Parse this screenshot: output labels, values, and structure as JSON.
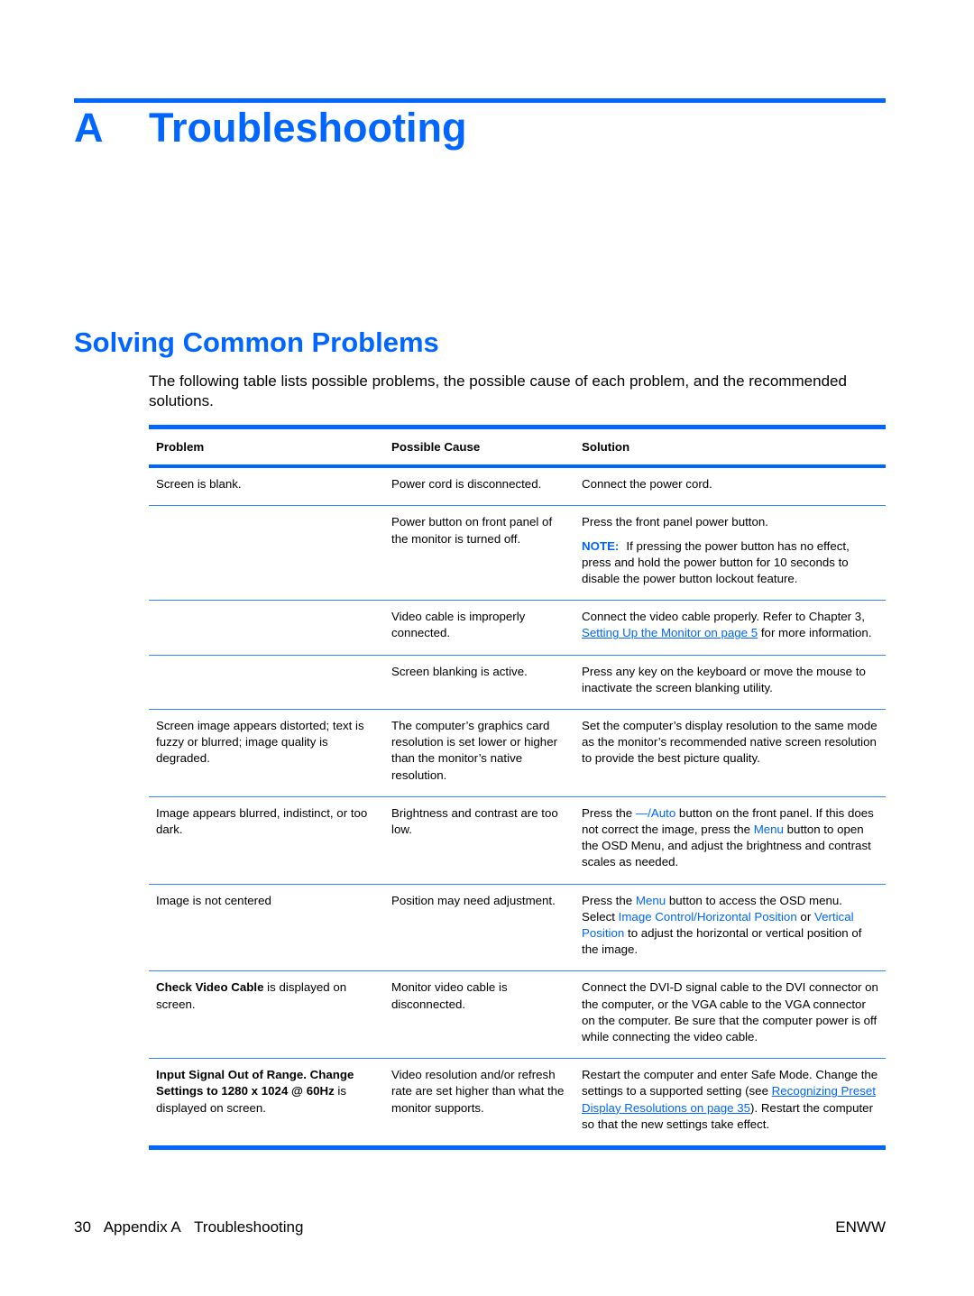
{
  "chapter": {
    "letter": "A",
    "title": "Troubleshooting"
  },
  "section": {
    "title": "Solving Common Problems"
  },
  "intro": "The following table lists possible problems, the possible cause of each problem, and the recommended solutions.",
  "table": {
    "headers": [
      "Problem",
      "Possible Cause",
      "Solution"
    ],
    "rows": [
      {
        "problem": "Screen is blank.",
        "cause": "Power cord is disconnected.",
        "solution": "Connect the power cord."
      },
      {
        "problem": "",
        "cause": "Power button on front panel of the monitor is turned off.",
        "solution": "Press the front panel power button.",
        "note_label": "NOTE:",
        "note": "If pressing the power button has no effect, press and hold the power button for 10 seconds to disable the power button lockout feature."
      },
      {
        "problem": "",
        "cause": "Video cable is improperly connected.",
        "solution_pre": "Connect the video cable properly. Refer to Chapter 3, ",
        "solution_link": "Setting Up the Monitor on page 5",
        "solution_post": " for more information."
      },
      {
        "problem": "",
        "cause": "Screen blanking is active.",
        "solution": "Press any key on the keyboard or move the mouse to inactivate the screen blanking utility."
      },
      {
        "problem": "Screen image appears distorted; text is fuzzy or blurred; image quality is degraded.",
        "cause": "The computer’s graphics card resolution is set lower or higher than the monitor’s native resolution.",
        "solution": "Set the computer’s display resolution to the same mode as the monitor’s recommended native screen resolution to provide the best picture quality."
      },
      {
        "problem": "Image appears blurred, indistinct, or too dark.",
        "cause": "Brightness and contrast are too low.",
        "solution_a": "Press the ",
        "solution_b": "—/Auto",
        "solution_c": " button on the front panel. If this does not correct the image, press the ",
        "solution_d": "Menu",
        "solution_e": " button to open the OSD Menu, and adjust the brightness and contrast scales as needed."
      },
      {
        "problem": "Image is not centered",
        "cause": "Position may need adjustment.",
        "solution_a": "Press the ",
        "solution_b": "Menu",
        "solution_c": " button to access the OSD menu. Select ",
        "solution_d": "Image Control/Horizontal Position",
        "solution_e": " or ",
        "solution_f": "Vertical Position",
        "solution_g": " to adjust the horizontal or vertical position of the image."
      },
      {
        "problem_bold": "Check Video Cable",
        "problem_rest": " is displayed on screen.",
        "cause": "Monitor video cable is disconnected.",
        "solution": "Connect the DVI-D signal cable to the DVI connector on the computer, or the VGA cable to the VGA connector on the computer. Be sure that the computer power is off while connecting the video cable."
      },
      {
        "problem_bold": "Input Signal Out of Range. Change Settings to 1280 x 1024 @ 60Hz",
        "problem_rest": " is displayed on screen.",
        "cause": "Video resolution and/or refresh rate are set higher than what the monitor supports.",
        "solution_pre": "Restart the computer and enter Safe Mode. Change the settings to a supported setting (see ",
        "solution_link": "Recognizing Preset Display Resolutions on page 35",
        "solution_post": "). Restart the computer so that the new settings take effect."
      }
    ]
  },
  "footer": {
    "page_number": "30",
    "appendix": "Appendix A",
    "chapter": "Troubleshooting",
    "locale": "ENWW"
  }
}
